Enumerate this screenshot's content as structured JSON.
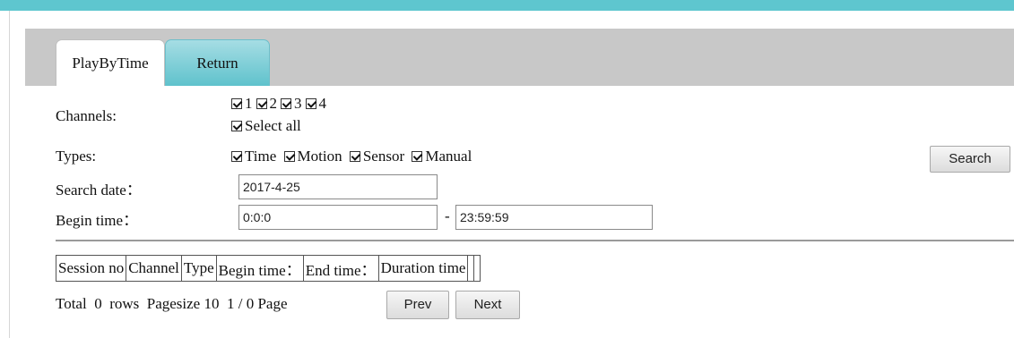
{
  "tabs": [
    {
      "label": "PlayByTime",
      "active": true
    },
    {
      "label": "Return",
      "active": false
    }
  ],
  "channels": {
    "label": "Channels:",
    "options": [
      {
        "label": "1",
        "checked": true
      },
      {
        "label": "2",
        "checked": true
      },
      {
        "label": "3",
        "checked": true
      },
      {
        "label": "4",
        "checked": true
      }
    ],
    "select_all": {
      "label": "Select all",
      "checked": true
    }
  },
  "types": {
    "label": "Types:",
    "options": [
      {
        "label": "Time",
        "checked": true
      },
      {
        "label": "Motion",
        "checked": true
      },
      {
        "label": "Sensor",
        "checked": true
      },
      {
        "label": "Manual",
        "checked": true
      }
    ]
  },
  "search_date": {
    "label": "Search date：",
    "value": "2017-4-25"
  },
  "begin_time": {
    "label": "Begin time：",
    "start": "0:0:0",
    "separator": "-",
    "end": "23:59:59"
  },
  "search_button": "Search",
  "table": {
    "headers": [
      "Session no",
      "Channel",
      "Type",
      "Begin time：",
      "End time：",
      "Duration time"
    ]
  },
  "pager": {
    "total": "Total  0  rows  Pagesize 10  1 / 0 Page",
    "prev": "Prev",
    "next": "Next"
  },
  "colors": {
    "accent": "#5ec6cf",
    "tab_bar": "#c8c8c8"
  }
}
